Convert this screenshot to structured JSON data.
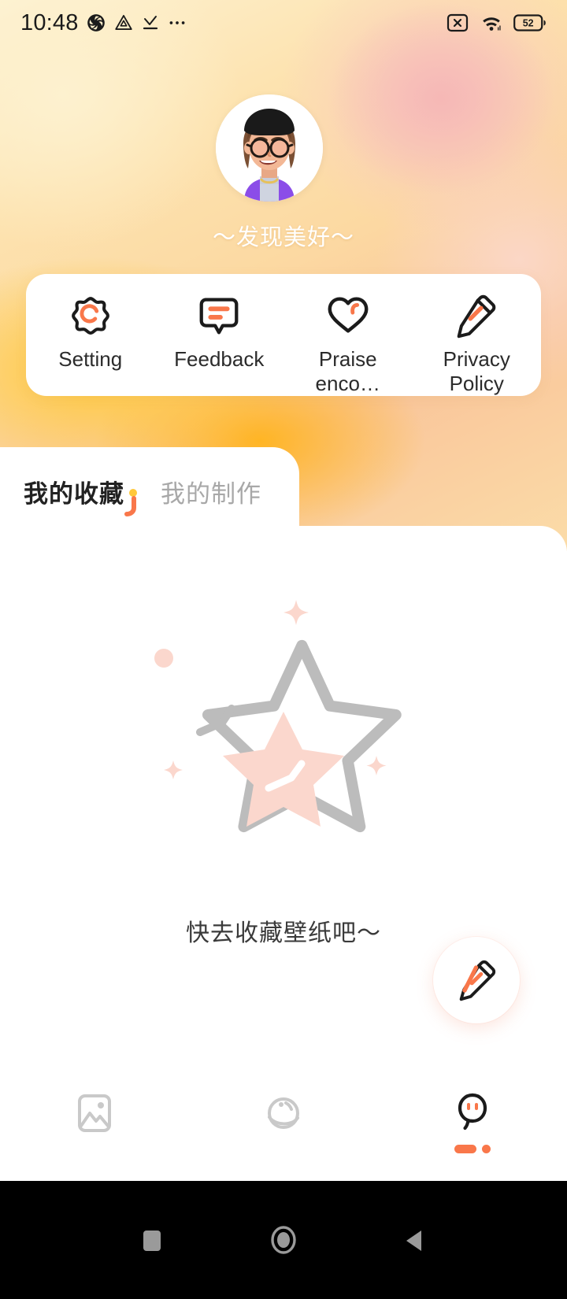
{
  "status_bar": {
    "time": "10:48",
    "left_icons": [
      "shutter-app-icon",
      "triangle-app-icon",
      "download-complete-icon",
      "more-dots-icon"
    ],
    "right_icons": [
      "sim-off-icon",
      "wifi-icon",
      "battery-icon"
    ],
    "battery_level": "52"
  },
  "profile": {
    "avatar": "user-avatar",
    "username": "～发现美好～"
  },
  "menu": {
    "items": [
      {
        "id": "setting",
        "label": "Setting",
        "icon": "gear-icon"
      },
      {
        "id": "feedback",
        "label": "Feedback",
        "icon": "speech-bubble-icon"
      },
      {
        "id": "praise",
        "label": "Praise enco…",
        "icon": "heart-icon"
      },
      {
        "id": "privacy",
        "label": "Privacy\nPolicy",
        "icon": "pencil-icon"
      }
    ]
  },
  "tabs": [
    {
      "id": "favorites",
      "label": "我的收藏",
      "active": true
    },
    {
      "id": "creations",
      "label": "我的制作",
      "active": false
    }
  ],
  "empty_state": {
    "illustration": "star-empty-illustration",
    "message": "快去收藏壁纸吧～"
  },
  "fab": {
    "label": "edit-fab",
    "icon": "pencil-icon"
  },
  "bottom_nav": [
    {
      "id": "wallpaper",
      "icon": "image-icon",
      "active": false
    },
    {
      "id": "discover",
      "icon": "planet-icon",
      "active": false
    },
    {
      "id": "profile",
      "icon": "ghost-face-icon",
      "active": true
    }
  ],
  "android_nav": [
    {
      "id": "recents",
      "icon": "square-icon"
    },
    {
      "id": "home",
      "icon": "circle-icon"
    },
    {
      "id": "back",
      "icon": "triangle-back-icon"
    }
  ],
  "colors": {
    "accent": "#f9774a",
    "accent_yellow": "#ffc83a",
    "pink_soft": "#fbd7cd",
    "gray_outline": "#bcbcbc",
    "text_dark": "#2b2b2b",
    "text_muted": "#a8a8a8"
  }
}
